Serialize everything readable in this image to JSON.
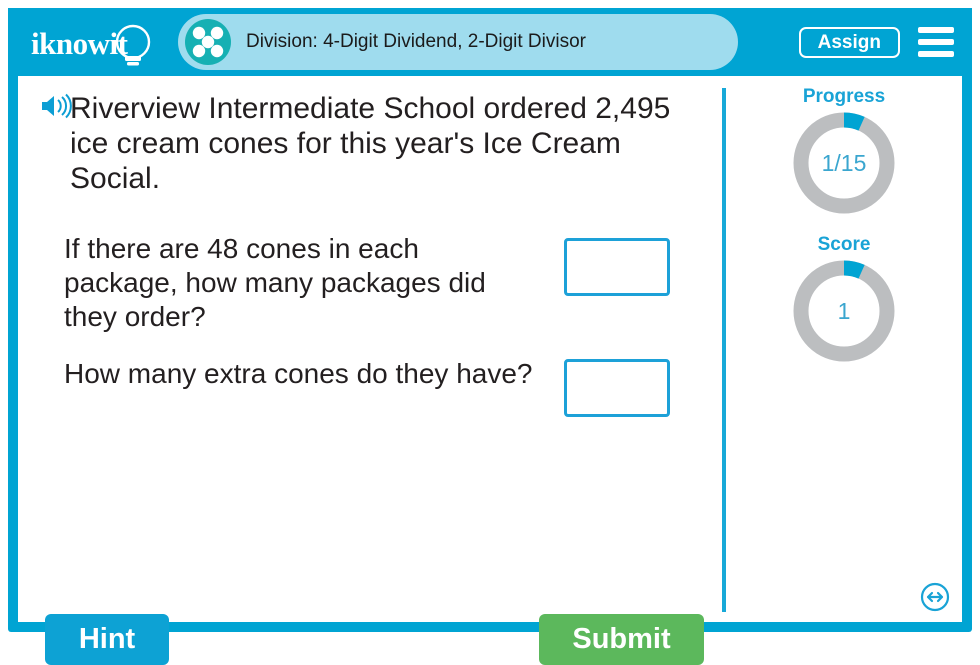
{
  "header": {
    "logo_text": "iknowit",
    "logo_icon": "lightbulb-icon",
    "topic_icon": "five-dot-circle-icon",
    "title": "Division: 4-Digit Dividend, 2-Digit Divisor",
    "assign_label": "Assign",
    "menu_icon": "hamburger-menu-icon",
    "bar_color": "#00a4d3",
    "band_color": "#9fdcee"
  },
  "question": {
    "speaker_icon": "speaker-audio-icon",
    "stem": "Riverview Intermediate School ordered 2,495 ice cream cones for this year's Ice Cream Social.",
    "parts": [
      {
        "text": "If there are 48 cones in each package, how many packages did they order?",
        "answer_value": "",
        "answer_placeholder": ""
      },
      {
        "text": "How many extra cones do they have?",
        "answer_value": "",
        "answer_placeholder": ""
      }
    ]
  },
  "actions": {
    "hint_label": "Hint",
    "submit_label": "Submit",
    "hint_color": "#0da2d4",
    "submit_color": "#5cb85c"
  },
  "sidebar": {
    "progress": {
      "label": "Progress",
      "value": "1/15",
      "current": 1,
      "total": 15,
      "percent": 6.7,
      "arc_color": "#00a4d3",
      "track_color": "#bcbec0"
    },
    "score": {
      "label": "Score",
      "value": "1",
      "percent": 6.7,
      "arc_color": "#00a4d3",
      "track_color": "#bcbec0"
    },
    "resize_icon": "resize-horizontal-icon"
  }
}
